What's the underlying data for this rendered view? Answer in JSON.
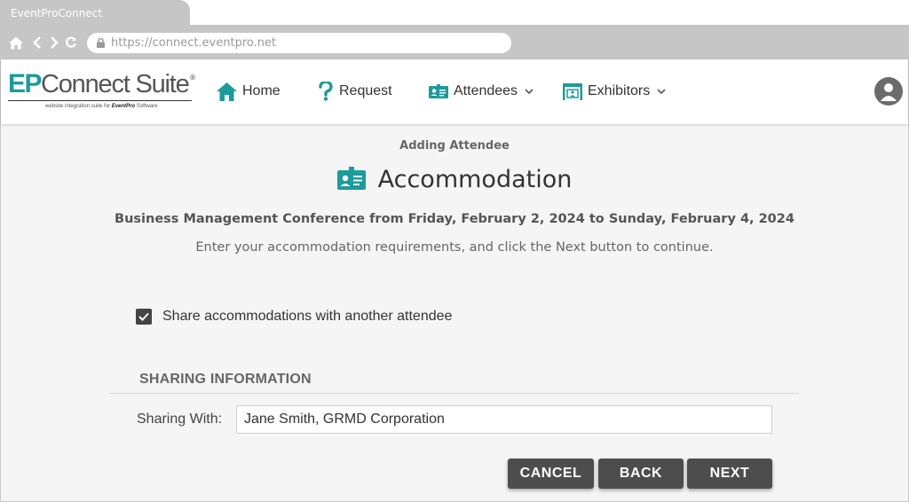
{
  "browser": {
    "tab_title": "EventProConnect",
    "url": "https://connect.eventpro.net"
  },
  "logo": {
    "brand_ep": "EP",
    "brand_rest": "Connect Suite",
    "registered": "®",
    "tagline_prefix": "website integration suite for",
    "tagline_brand": "EventPro",
    "tagline_suffix": "Software"
  },
  "nav": {
    "items": [
      {
        "label": "Home",
        "icon": "home-icon"
      },
      {
        "label": "Request",
        "icon": "question-icon"
      },
      {
        "label": "Attendees",
        "icon": "id-badge-icon",
        "dropdown": true
      },
      {
        "label": "Exhibitors",
        "icon": "booth-icon",
        "dropdown": true
      }
    ],
    "accent_color": "#1c9b9b"
  },
  "page": {
    "eyebrow": "Adding Attendee",
    "title": "Accommodation",
    "event_line": "Business Management Conference from Friday, February 2, 2024 to Sunday, February 4, 2024",
    "instructions": "Enter your accommodation requirements, and click the Next button to continue."
  },
  "form": {
    "share_checkbox_label": "Share accommodations with another attendee",
    "share_checked": true,
    "section_title": "SHARING INFORMATION",
    "sharing_with_label": "Sharing With:",
    "sharing_with_value": "Jane Smith, GRMD Corporation"
  },
  "buttons": {
    "cancel": "CANCEL",
    "back": "BACK",
    "next": "NEXT"
  }
}
